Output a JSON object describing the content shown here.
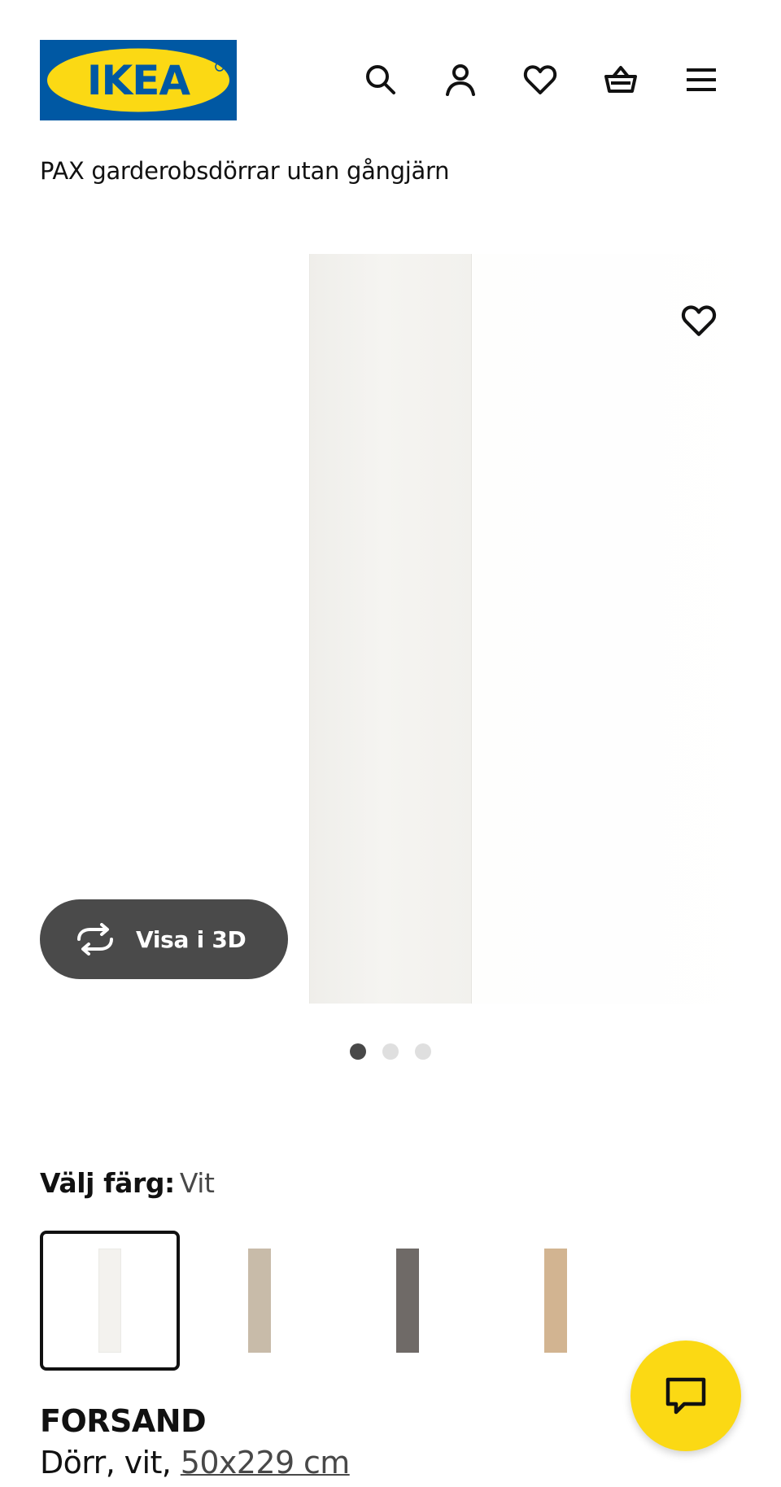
{
  "header": {
    "logo_text": "IKEA",
    "logo_colors": {
      "background": "#0058a3",
      "oval": "#fbd914",
      "text": "#0058a3"
    },
    "icons": [
      "search-icon",
      "account-icon",
      "favourites-icon",
      "cart-icon",
      "menu-icon"
    ]
  },
  "breadcrumb": "PAX garderobsdörrar utan gångjärn",
  "gallery": {
    "view_3d_label": "Visa i 3D",
    "slide_count": 3,
    "active_slide": 1
  },
  "color_selector": {
    "label": "Välj färg:",
    "value": "Vit",
    "swatches": [
      {
        "name": "Vit",
        "color": "#f3f2ee",
        "selected": true
      },
      {
        "name": "beige",
        "color": "#c8bba9",
        "selected": false
      },
      {
        "name": "gray",
        "color": "#6f6a67",
        "selected": false
      },
      {
        "name": "wood",
        "color": "#d2b491",
        "selected": false
      }
    ]
  },
  "product": {
    "name": "FORSAND",
    "description_prefix": "Dörr, vit, ",
    "measure": "50x229 cm"
  },
  "colors": {
    "accent": "#fbd914",
    "brand_blue": "#0058a3",
    "dark_button": "#4a4a4a"
  }
}
